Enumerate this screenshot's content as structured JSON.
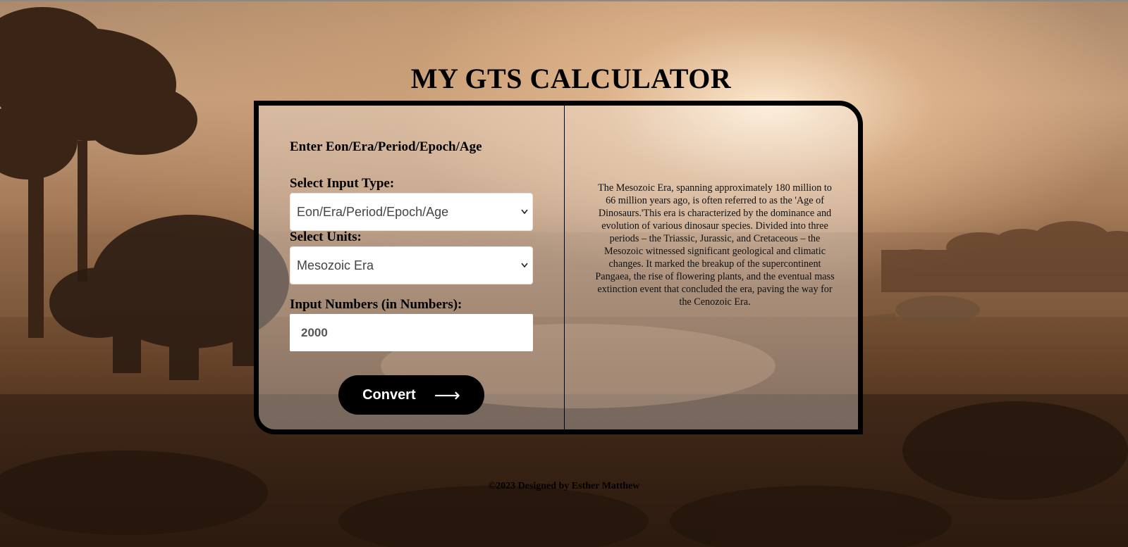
{
  "page": {
    "title": "MY GTS CALCULATOR"
  },
  "form": {
    "heading": "Enter Eon/Era/Period/Epoch/Age",
    "input_type_label": "Select Input Type:",
    "input_type_value": "Eon/Era/Period/Epoch/Age",
    "units_label": "Select Units:",
    "units_value": "Mesozoic Era",
    "number_label": "Input Numbers (in Numbers):",
    "number_value": "2000",
    "convert_label": "Convert",
    "convert_arrow": "⟶"
  },
  "info": {
    "description": "The Mesozoic Era, spanning approximately 180 million to 66 million years ago, is often referred to as the 'Age of Dinosaurs.'This era is characterized by the dominance and evolution of various dinosaur species. Divided into three periods – the Triassic, Jurassic, and Cretaceous – the Mesozoic witnessed significant geological and climatic changes. It marked the breakup of the supercontinent Pangaea, the rise of flowering plants, and the eventual mass extinction event that concluded the era, paving the way for the Cenozoic Era."
  },
  "footer": {
    "text": "©2023 Designed by Esther Matthew"
  },
  "icons": {
    "select_chevron": "chevron-down-icon",
    "convert_arrow": "arrow-right-icon"
  },
  "colors": {
    "card_border": "#000000",
    "button_bg": "#000000",
    "button_text": "#ffffff"
  }
}
